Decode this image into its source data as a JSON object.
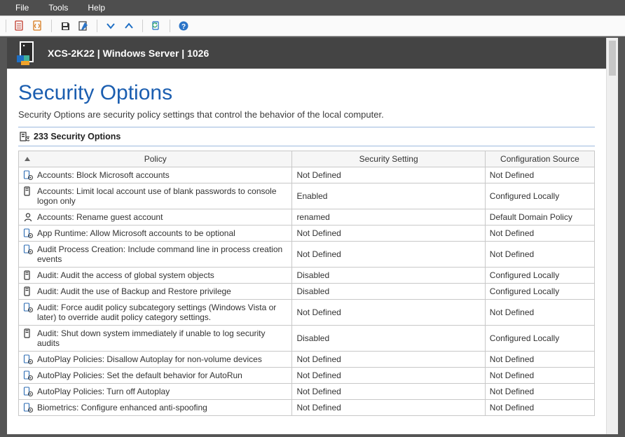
{
  "menu": {
    "file": "File",
    "tools": "Tools",
    "help": "Help"
  },
  "header": {
    "title": "XCS-2K22 | Windows Server | 1026"
  },
  "page": {
    "title": "Security Options",
    "description": "Security Options are security policy settings that control the behavior of the local computer.",
    "section_count_label": "233 Security Options"
  },
  "columns": {
    "policy": "Policy",
    "setting": "Security Setting",
    "source": "Configuration Source"
  },
  "rows": [
    {
      "icon": "policy",
      "policy": "Accounts: Block Microsoft accounts",
      "setting": "Not Defined",
      "source": "Not Defined"
    },
    {
      "icon": "device",
      "policy": "Accounts: Limit local account use of blank passwords to console logon only",
      "setting": "Enabled",
      "source": "Configured Locally"
    },
    {
      "icon": "user",
      "policy": "Accounts: Rename guest account",
      "setting": "renamed",
      "source": "Default Domain Policy"
    },
    {
      "icon": "policy",
      "policy": "App Runtime: Allow Microsoft accounts to be optional",
      "setting": "Not Defined",
      "source": "Not Defined"
    },
    {
      "icon": "policy",
      "policy": "Audit Process Creation: Include command line in process creation events",
      "setting": "Not Defined",
      "source": "Not Defined"
    },
    {
      "icon": "device",
      "policy": "Audit: Audit the access of global system objects",
      "setting": "Disabled",
      "source": "Configured Locally"
    },
    {
      "icon": "device",
      "policy": "Audit: Audit the use of Backup and Restore privilege",
      "setting": "Disabled",
      "source": "Configured Locally"
    },
    {
      "icon": "policy",
      "policy": "Audit: Force audit policy subcategory settings (Windows Vista or later) to override audit policy category settings.",
      "setting": "Not Defined",
      "source": "Not Defined"
    },
    {
      "icon": "device",
      "policy": "Audit: Shut down system immediately if unable to log security audits",
      "setting": "Disabled",
      "source": "Configured Locally"
    },
    {
      "icon": "policy",
      "policy": "AutoPlay Policies: Disallow Autoplay for non-volume devices",
      "setting": "Not Defined",
      "source": "Not Defined"
    },
    {
      "icon": "policy",
      "policy": "AutoPlay Policies: Set the default behavior for AutoRun",
      "setting": "Not Defined",
      "source": "Not Defined"
    },
    {
      "icon": "policy",
      "policy": "AutoPlay Policies: Turn off Autoplay",
      "setting": "Not Defined",
      "source": "Not Defined"
    },
    {
      "icon": "policy",
      "policy": "Biometrics: Configure enhanced anti-spoofing",
      "setting": "Not Defined",
      "source": "Not Defined"
    }
  ]
}
